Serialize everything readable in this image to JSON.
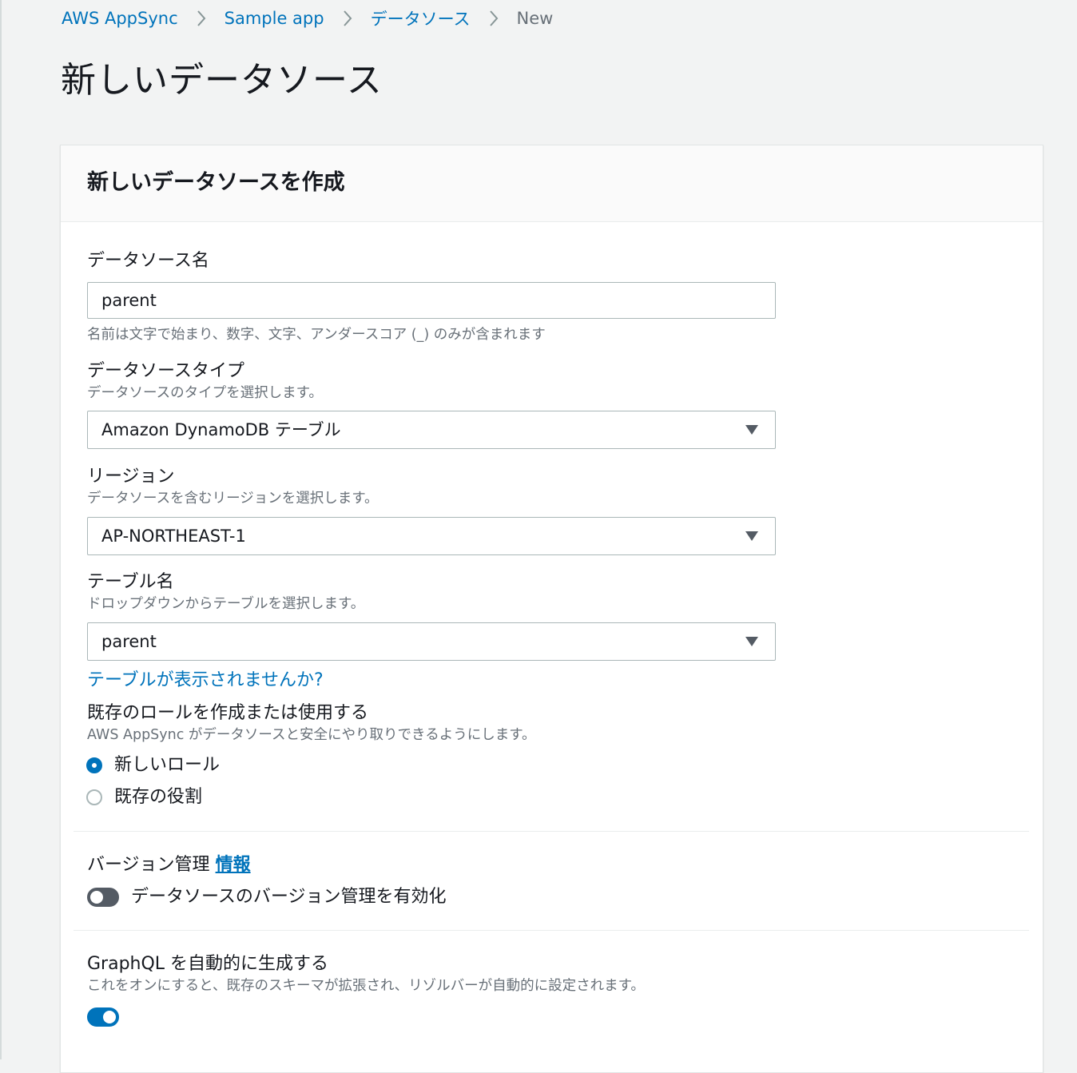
{
  "breadcrumb": {
    "items": [
      "AWS AppSync",
      "Sample app",
      "データソース"
    ],
    "current": "New"
  },
  "page_title": "新しいデータソース",
  "panel": {
    "title": "新しいデータソースを作成",
    "data_source_name": {
      "label": "データソース名",
      "value": "parent",
      "help": "名前は文字で始まり、数字、文字、アンダースコア (_) のみが含まれます"
    },
    "data_source_type": {
      "label": "データソースタイプ",
      "description": "データソースのタイプを選択します。",
      "selected": "Amazon DynamoDB テーブル"
    },
    "region": {
      "label": "リージョン",
      "description": "データソースを含むリージョンを選択します。",
      "selected": "AP-NORTHEAST-1"
    },
    "table_name": {
      "label": "テーブル名",
      "description": "ドロップダウンからテーブルを選択します。",
      "selected": "parent",
      "missing_link": "テーブルが表示されませんか?"
    },
    "role": {
      "label": "既存のロールを作成または使用する",
      "description": "AWS AppSync がデータソースと安全にやり取りできるようにします。",
      "options": [
        {
          "label": "新しいロール",
          "checked": true
        },
        {
          "label": "既存の役割",
          "checked": false
        }
      ]
    },
    "versioning": {
      "label": "バージョン管理",
      "info_link": "情報",
      "toggle_label": "データソースのバージョン管理を有効化",
      "enabled": false
    },
    "graphql": {
      "label": "GraphQL を自動的に生成する",
      "description": "これをオンにすると、既存のスキーマが拡張され、リゾルバーが自動的に設定されます。",
      "enabled": true
    }
  },
  "icons": {
    "breadcrumb_separator": "chevron-right-icon",
    "select_caret": "caret-down-icon"
  },
  "colors": {
    "link": "#0073bb",
    "background": "#f2f3f3",
    "toggle_off": "#545b64",
    "toggle_on": "#0073bb"
  }
}
